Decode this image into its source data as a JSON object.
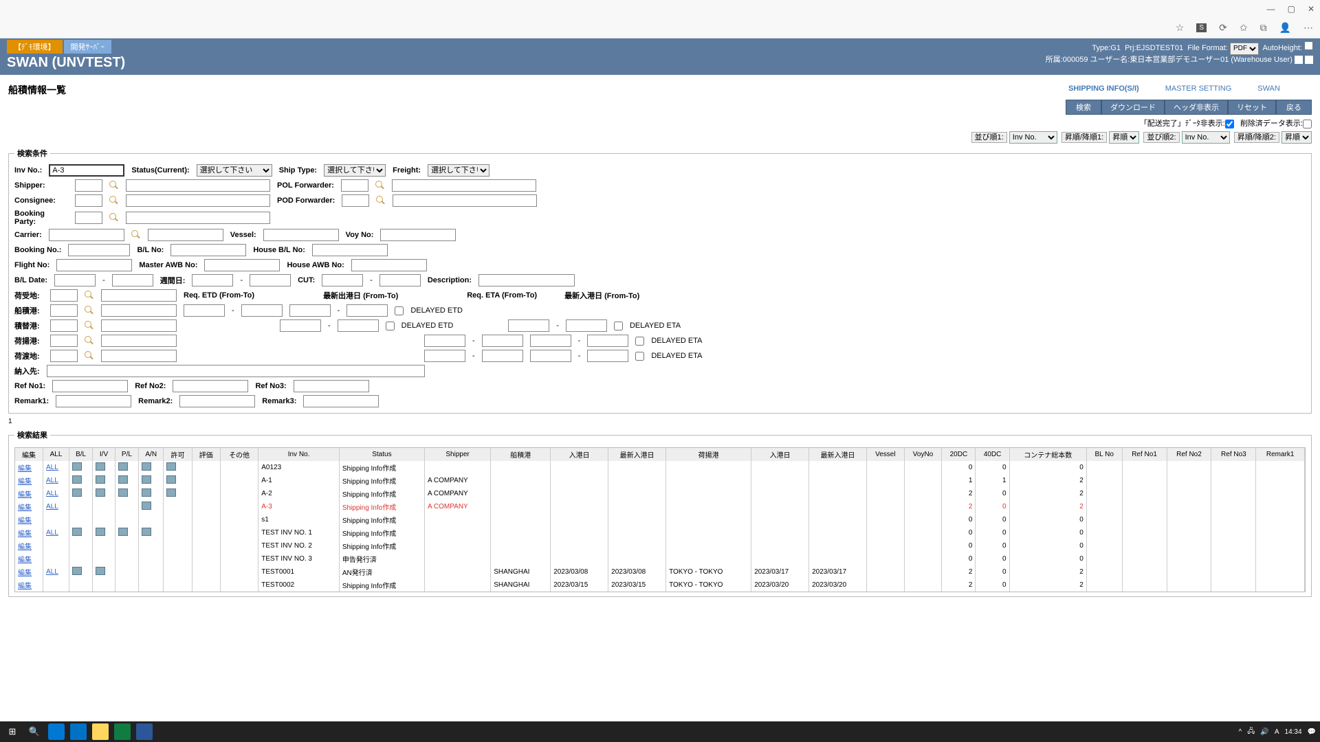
{
  "browser": {
    "min": "—",
    "max": "▢",
    "close": "✕"
  },
  "env_tabs": [
    "【ﾃﾞﾓ環境】",
    "開発ｻｰﾊﾞｰ"
  ],
  "app_title": "SWAN (UNVTEST)",
  "header": {
    "line1_type": "Type:G1",
    "line1_prj": "Prj:EJSDTEST01",
    "line1_ff": "File Format:",
    "line1_ff_val": "PDF",
    "line1_ah": "AutoHeight:",
    "line2": "所属:000059 ユーザー名:東日本営業部デモユーザー01 (Warehouse User)"
  },
  "page_title": "船積情報一覧",
  "nav": [
    "SHIPPING INFO(S/I)",
    "MASTER SETTING",
    "SWAN"
  ],
  "buttons": [
    "検索",
    "ダウンロード",
    "ヘッダ非表示",
    "リセット",
    "戻る"
  ],
  "opts": {
    "opt1": "「配送完了」ﾃﾞｰﾀ非表示:",
    "opt2": "削除済データ表示:"
  },
  "sort": {
    "l1": "並び順1:",
    "v1": "Inv No.",
    "asc1": "昇順/降順1:",
    "av1": "昇順",
    "l2": "並び順2:",
    "v2": "Inv No.",
    "asc2": "昇順/降順2:",
    "av2": "昇順"
  },
  "legend_search": "検索条件",
  "labels": {
    "invno": "Inv No.:",
    "status": "Status(Current):",
    "shiptype": "Ship Type:",
    "freight": "Freight:",
    "select_ph": "選択して下さい",
    "shipper": "Shipper:",
    "consignee": "Consignee:",
    "booking_party": "Booking Party:",
    "polf": "POL Forwarder:",
    "podf": "POD Forwarder:",
    "carrier": "Carrier:",
    "vessel": "Vessel:",
    "voy": "Voy No:",
    "booking_no": "Booking No.:",
    "blno": "B/L No:",
    "hblno": "House B/L No:",
    "flight": "Flight No:",
    "mawb": "Master AWB No:",
    "hawb": "House AWB No:",
    "bldate": "B/L Date:",
    "weekday": "週間日:",
    "cut": "CUT:",
    "desc": "Description:",
    "niukechi": "荷受地:",
    "reqetd": "Req. ETD (From-To)",
    "latest_dep": "最新出港日 (From-To)",
    "reqeta": "Req. ETA (From-To)",
    "latest_arr": "最新入港日 (From-To)",
    "funazumi": "船積港:",
    "tsumikae": "積替港:",
    "niage": "荷揚港:",
    "niwatashi": "荷渡地:",
    "delayed_etd": "DELAYED ETD",
    "delayed_eta": "DELAYED ETA",
    "nounyusaki": "納入先:",
    "ref1": "Ref No1:",
    "ref2": "Ref No2:",
    "ref3": "Ref No3:",
    "rem1": "Remark1:",
    "rem2": "Remark2:",
    "rem3": "Remark3:"
  },
  "invno_value": "A-3",
  "page_count": "1",
  "legend_result": "検索結果",
  "columns": [
    "編集",
    "ALL",
    "B/L",
    "I/V",
    "P/L",
    "A/N",
    "許可",
    "評価",
    "その他",
    "Inv No.",
    "Status",
    "Shipper",
    "船積港",
    "入港日",
    "最新入港日",
    "荷揚港",
    "入港日",
    "最新入港日",
    "Vessel",
    "VoyNo",
    "20DC",
    "40DC",
    "コンテナ総本数",
    "BL No",
    "Ref No1",
    "Ref No2",
    "Ref No3",
    "Remark1"
  ],
  "rows": [
    {
      "edit": "編集",
      "all": "ALL",
      "bl": true,
      "iv": true,
      "pl": true,
      "an": true,
      "perm": true,
      "inv": "A0123",
      "status": "Shipping Info作成",
      "shipper": "",
      "dc20": "0",
      "dc40": "0",
      "ct": "0"
    },
    {
      "edit": "編集",
      "all": "ALL",
      "bl": true,
      "iv": true,
      "pl": true,
      "an": true,
      "perm": true,
      "inv": "A-1",
      "status": "Shipping Info作成",
      "shipper": "A COMPANY",
      "dc20": "1",
      "dc40": "1",
      "ct": "2"
    },
    {
      "edit": "編集",
      "all": "ALL",
      "bl": true,
      "iv": true,
      "pl": true,
      "an": true,
      "perm": true,
      "inv": "A-2",
      "status": "Shipping Info作成",
      "shipper": "A COMPANY",
      "dc20": "2",
      "dc40": "0",
      "ct": "2"
    },
    {
      "edit": "編集",
      "all": "ALL",
      "bl": false,
      "iv": false,
      "pl": false,
      "an": true,
      "perm": false,
      "inv": "A-3",
      "status": "Shipping Info作成",
      "shipper": "A COMPANY",
      "dc20": "2",
      "dc40": "0",
      "ct": "2",
      "red": true
    },
    {
      "edit": "編集",
      "all": "",
      "bl": false,
      "iv": false,
      "pl": false,
      "an": false,
      "perm": false,
      "inv": "s1",
      "status": "Shipping Info作成",
      "shipper": "",
      "dc20": "0",
      "dc40": "0",
      "ct": "0"
    },
    {
      "edit": "編集",
      "all": "ALL",
      "bl": true,
      "iv": true,
      "pl": true,
      "an": true,
      "perm": false,
      "inv": "TEST INV NO. 1",
      "status": "Shipping Info作成",
      "shipper": "",
      "dc20": "0",
      "dc40": "0",
      "ct": "0"
    },
    {
      "edit": "編集",
      "all": "",
      "bl": false,
      "iv": false,
      "pl": false,
      "an": false,
      "perm": false,
      "inv": "TEST INV NO. 2",
      "status": "Shipping Info作成",
      "shipper": "",
      "dc20": "0",
      "dc40": "0",
      "ct": "0"
    },
    {
      "edit": "編集",
      "all": "",
      "bl": false,
      "iv": false,
      "pl": false,
      "an": false,
      "perm": false,
      "inv": "TEST INV NO. 3",
      "status": "申告発行済",
      "shipper": "",
      "dc20": "0",
      "dc40": "0",
      "ct": "0"
    },
    {
      "edit": "編集",
      "all": "ALL",
      "bl": true,
      "iv": true,
      "pl": false,
      "an": false,
      "perm": false,
      "inv": "TEST0001",
      "status": "AN発行済",
      "shipper": "",
      "pol": "SHANGHAI",
      "etd": "2023/03/08",
      "letd": "2023/03/08",
      "pod": "TOKYO - TOKYO",
      "eta": "2023/03/17",
      "leta": "2023/03/17",
      "dc20": "2",
      "dc40": "0",
      "ct": "2"
    },
    {
      "edit": "編集",
      "all": "",
      "bl": false,
      "iv": false,
      "pl": false,
      "an": false,
      "perm": false,
      "inv": "TEST0002",
      "status": "Shipping Info作成",
      "shipper": "",
      "pol": "SHANGHAI",
      "etd": "2023/03/15",
      "letd": "2023/03/15",
      "pod": "TOKYO - TOKYO",
      "eta": "2023/03/20",
      "leta": "2023/03/20",
      "dc20": "2",
      "dc40": "0",
      "ct": "2"
    }
  ],
  "taskbar": {
    "time": "14:34"
  }
}
